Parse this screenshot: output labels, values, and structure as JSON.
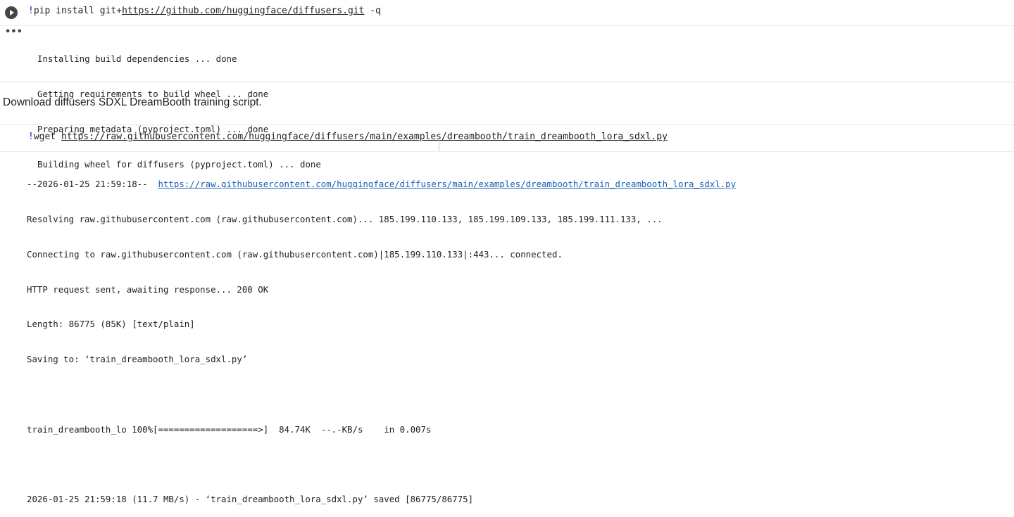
{
  "cell1": {
    "code_bang": "!",
    "code_cmd": "pip install git+",
    "code_url": "https://github.com/huggingface/diffusers.git",
    "code_flag": " -q",
    "more_glyph": "•••",
    "output_lines": [
      "Installing build dependencies ... done",
      "Getting requirements to build wheel ... done",
      "Preparing metadata (pyproject.toml) ... done",
      "Building wheel for diffusers (pyproject.toml) ... done"
    ]
  },
  "text_cell": {
    "text": "Download diffusers SDXL DreamBooth training script."
  },
  "cell2": {
    "code_bang": "!",
    "code_cmd": "wget ",
    "code_url": "https://raw.githubusercontent.com/huggingface/diffusers/main/examples/dreambooth/train_dreambooth_lora_sdxl.py",
    "output": {
      "timestamp_prefix": "--2026-01-25 21:59:18--  ",
      "link": "https://raw.githubusercontent.com/huggingface/diffusers/main/examples/dreambooth/train_dreambooth_lora_sdxl.py",
      "resolving": "Resolving raw.githubusercontent.com (raw.githubusercontent.com)... 185.199.110.133, 185.199.109.133, 185.199.111.133, ...",
      "connecting": "Connecting to raw.githubusercontent.com (raw.githubusercontent.com)|185.199.110.133|:443... connected.",
      "http_sent": "HTTP request sent, awaiting response... 200 OK",
      "length": "Length: 86775 (85K) [text/plain]",
      "saving": "Saving to: ‘train_dreambooth_lora_sdxl.py’",
      "progress": "train_dreambooth_lo 100%[===================>]  84.74K  --.-KB/s    in 0.007s",
      "saved": "2026-01-25 21:59:18 (11.7 MB/s) - ‘train_dreambooth_lora_sdxl.py’ saved [86775/86775]"
    }
  }
}
